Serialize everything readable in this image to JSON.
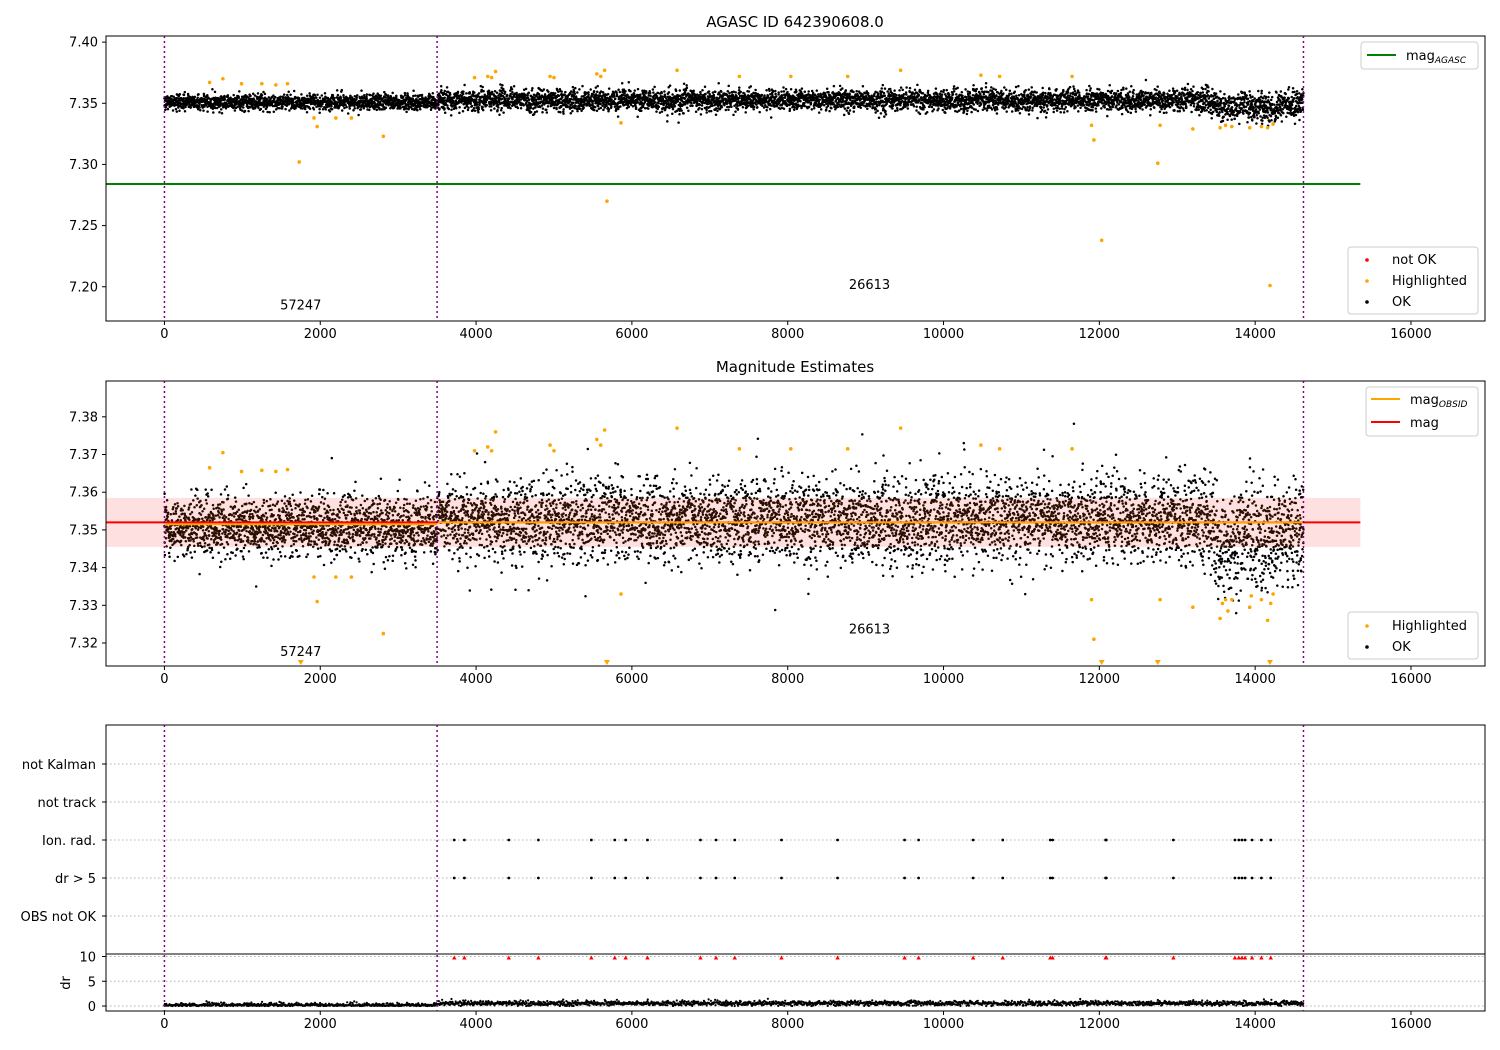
{
  "chart_data": [
    {
      "type": "scatter",
      "title": "AGASC ID 642390608.0",
      "xlabel": "",
      "ylabel": "",
      "xlim": [
        -750,
        16950
      ],
      "ylim": [
        7.172,
        7.405
      ],
      "x_ticks": [
        0,
        2000,
        4000,
        6000,
        8000,
        10000,
        12000,
        14000,
        16000
      ],
      "y_ticks": [
        7.2,
        7.25,
        7.3,
        7.35,
        7.4
      ],
      "y_tick_labels": [
        "7.20",
        "7.25",
        "7.30",
        "7.35",
        "7.40"
      ],
      "grid": false,
      "obsid_boundaries": [
        0,
        3500,
        14620
      ],
      "obsid_labels": [
        {
          "text": "57247",
          "x": 1750,
          "y": 7.1815
        },
        {
          "text": "26613",
          "x": 9050,
          "y": 7.198
        }
      ],
      "agasc_mag": 7.284,
      "agasc_mag_x_range": [
        -750,
        15350
      ],
      "series": [
        {
          "name": "not OK",
          "color": "#ff0000",
          "values": []
        },
        {
          "name": "Highlighted",
          "color": "#ffa500",
          "points": [
            [
              580,
              7.367
            ],
            [
              750,
              7.37
            ],
            [
              990,
              7.366
            ],
            [
              1250,
              7.366
            ],
            [
              1430,
              7.365
            ],
            [
              1580,
              7.366
            ],
            [
              1730,
              7.302
            ],
            [
              1920,
              7.338
            ],
            [
              1960,
              7.331
            ],
            [
              2200,
              7.338
            ],
            [
              2400,
              7.338
            ],
            [
              2810,
              7.323
            ],
            [
              3980,
              7.371
            ],
            [
              4150,
              7.372
            ],
            [
              4200,
              7.371
            ],
            [
              4250,
              7.376
            ],
            [
              4950,
              7.372
            ],
            [
              5000,
              7.371
            ],
            [
              5550,
              7.374
            ],
            [
              5600,
              7.372
            ],
            [
              5650,
              7.377
            ],
            [
              5680,
              7.27
            ],
            [
              5860,
              7.334
            ],
            [
              6580,
              7.377
            ],
            [
              7380,
              7.372
            ],
            [
              8040,
              7.372
            ],
            [
              8770,
              7.372
            ],
            [
              9450,
              7.377
            ],
            [
              10480,
              7.373
            ],
            [
              10720,
              7.372
            ],
            [
              11650,
              7.372
            ],
            [
              11900,
              7.332
            ],
            [
              11930,
              7.32
            ],
            [
              12030,
              7.238
            ],
            [
              12750,
              7.301
            ],
            [
              12780,
              7.332
            ],
            [
              13200,
              7.329
            ],
            [
              13550,
              7.33
            ],
            [
              13620,
              7.332
            ],
            [
              13700,
              7.331
            ],
            [
              13930,
              7.33
            ],
            [
              14080,
              7.331
            ],
            [
              14160,
              7.33
            ],
            [
              14190,
              7.201
            ],
            [
              14230,
              7.333
            ]
          ]
        },
        {
          "name": "OK",
          "color": "#000000",
          "generated_band": true
        }
      ],
      "legends": [
        {
          "position": "upper right",
          "entries": [
            {
              "label": "mag",
              "subscript": "AGASC",
              "kind": "line",
              "color": "#008000"
            }
          ]
        },
        {
          "position": "lower right",
          "entries": [
            {
              "label": "not OK",
              "kind": "dot",
              "color": "#ff0000"
            },
            {
              "label": "Highlighted",
              "kind": "dot",
              "color": "#ffa500"
            },
            {
              "label": "OK",
              "kind": "dot",
              "color": "#000000"
            }
          ]
        }
      ]
    },
    {
      "type": "scatter",
      "title": "Magnitude Estimates",
      "xlabel": "",
      "ylabel": "",
      "xlim": [
        -750,
        16950
      ],
      "ylim": [
        7.3139,
        7.3895
      ],
      "x_ticks": [
        0,
        2000,
        4000,
        6000,
        8000,
        10000,
        12000,
        14000,
        16000
      ],
      "y_ticks": [
        7.32,
        7.33,
        7.34,
        7.35,
        7.36,
        7.37,
        7.38
      ],
      "y_tick_labels": [
        "7.32",
        "7.33",
        "7.34",
        "7.35",
        "7.36",
        "7.37",
        "7.38"
      ],
      "grid": false,
      "obsid_boundaries": [
        0,
        3500,
        14620
      ],
      "obsid_labels": [
        {
          "text": "57247",
          "x": 1750,
          "y": 7.3165
        },
        {
          "text": "26613",
          "x": 9050,
          "y": 7.3225
        }
      ],
      "mag": 7.352,
      "mag_band": [
        7.3455,
        7.3585
      ],
      "obsid_mags": [
        {
          "x": [
            0,
            3500
          ],
          "mag": 7.3515
        },
        {
          "x": [
            3500,
            14620
          ],
          "mag": 7.352
        }
      ],
      "offscale_points_x": [
        1750,
        5680,
        12030,
        12750,
        14190
      ],
      "series": [
        {
          "name": "Highlighted",
          "color": "#ffa500",
          "points": [
            [
              580,
              7.3665
            ],
            [
              750,
              7.3705
            ],
            [
              990,
              7.3655
            ],
            [
              1250,
              7.3658
            ],
            [
              1430,
              7.3655
            ],
            [
              1580,
              7.366
            ],
            [
              1920,
              7.3375
            ],
            [
              1960,
              7.331
            ],
            [
              2200,
              7.3375
            ],
            [
              2400,
              7.3375
            ],
            [
              2810,
              7.3225
            ],
            [
              3980,
              7.371
            ],
            [
              4150,
              7.372
            ],
            [
              4200,
              7.371
            ],
            [
              4250,
              7.376
            ],
            [
              4950,
              7.3725
            ],
            [
              5000,
              7.371
            ],
            [
              5550,
              7.374
            ],
            [
              5600,
              7.3725
            ],
            [
              5650,
              7.3765
            ],
            [
              5860,
              7.333
            ],
            [
              6580,
              7.377
            ],
            [
              7380,
              7.3715
            ],
            [
              8040,
              7.3715
            ],
            [
              8770,
              7.3715
            ],
            [
              9450,
              7.377
            ],
            [
              10480,
              7.3725
            ],
            [
              10720,
              7.3715
            ],
            [
              11650,
              7.3715
            ],
            [
              11900,
              7.3315
            ],
            [
              11930,
              7.321
            ],
            [
              12780,
              7.3315
            ],
            [
              13200,
              7.3295
            ],
            [
              13550,
              7.3265
            ],
            [
              13580,
              7.3305
            ],
            [
              13620,
              7.3315
            ],
            [
              13650,
              7.3285
            ],
            [
              13700,
              7.3315
            ],
            [
              13930,
              7.3295
            ],
            [
              13950,
              7.3325
            ],
            [
              14080,
              7.3315
            ],
            [
              14160,
              7.326
            ],
            [
              14200,
              7.3305
            ],
            [
              14230,
              7.333
            ]
          ]
        },
        {
          "name": "OK",
          "color": "#000000",
          "generated_band": true
        }
      ],
      "legends": [
        {
          "position": "upper right",
          "entries": [
            {
              "label": "mag",
              "subscript": "OBSID",
              "kind": "line",
              "color": "#ffa500"
            },
            {
              "label": "mag",
              "kind": "line",
              "color": "#ff0000"
            }
          ]
        },
        {
          "position": "lower right",
          "entries": [
            {
              "label": "Highlighted",
              "kind": "dot",
              "color": "#ffa500"
            },
            {
              "label": "OK",
              "kind": "dot",
              "color": "#000000"
            }
          ]
        }
      ]
    },
    {
      "type": "scatter",
      "title": "",
      "xlabel": "",
      "ylabel": "",
      "xlim": [
        -750,
        16950
      ],
      "grid": true,
      "obsid_boundaries": [
        0,
        3500,
        14620
      ],
      "flag_rows": [
        "not Kalman",
        "not track",
        "Ion. rad.",
        "dr > 5",
        "OBS not OK"
      ],
      "flag_points": {
        "Ion. rad.": [
          3720,
          3850,
          4420,
          4800,
          5480,
          5780,
          5920,
          6200,
          6880,
          7080,
          7320,
          7920,
          8640,
          9500,
          9680,
          10380,
          10760,
          11370,
          11400,
          12080,
          12090,
          12950,
          13740,
          13790,
          13830,
          13870,
          13960,
          14080,
          14200
        ],
        "dr > 5": [
          3720,
          3850,
          4420,
          4800,
          5480,
          5780,
          5920,
          6200,
          6880,
          7080,
          7320,
          7920,
          8640,
          9500,
          9680,
          10380,
          10760,
          11370,
          11400,
          12080,
          12090,
          12950,
          13740,
          13790,
          13830,
          13870,
          13960,
          14080,
          14200
        ]
      },
      "dr_panel": {
        "ylabel": "dr",
        "y_ticks": [
          0,
          5,
          10
        ],
        "y_tick_labels": [
          "0",
          "5",
          "10"
        ],
        "ylim": [
          -1,
          10.5
        ],
        "capped_x": [
          3720,
          3850,
          4420,
          4800,
          5480,
          5780,
          5920,
          6200,
          6880,
          7080,
          7320,
          7920,
          8640,
          9500,
          9680,
          10380,
          10760,
          11370,
          11400,
          12080,
          12090,
          12950,
          13740,
          13790,
          13830,
          13870,
          13960,
          14080,
          14200
        ],
        "capped_y": 9.8,
        "x_ticks": [
          0,
          2000,
          4000,
          6000,
          8000,
          10000,
          12000,
          14000,
          16000
        ]
      }
    }
  ]
}
